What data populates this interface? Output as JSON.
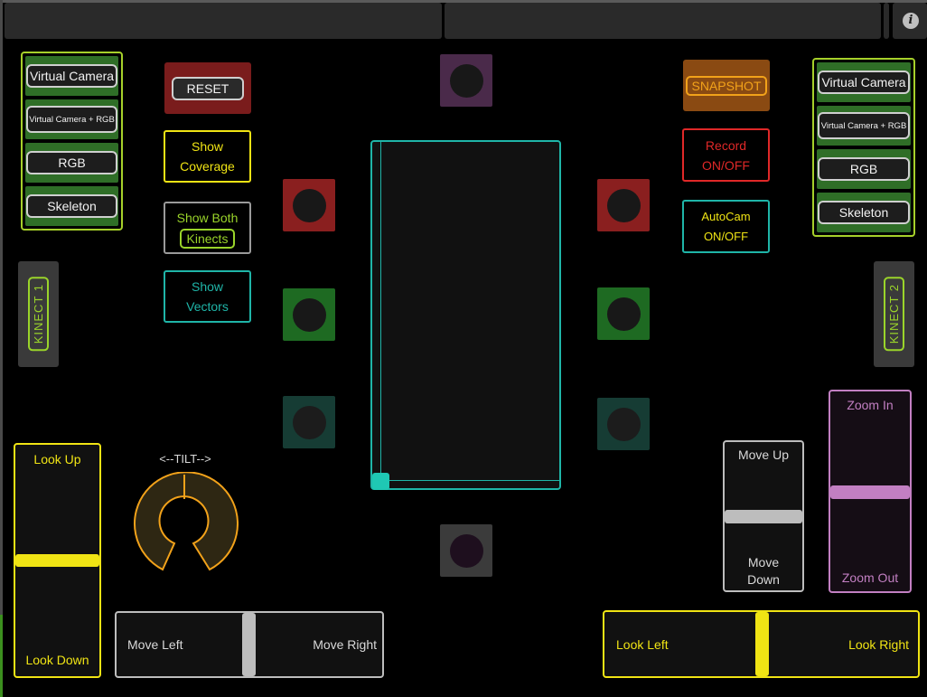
{
  "left_modes": [
    "Virtual Camera",
    "Virtual Camera + RGB",
    "RGB",
    "Skeleton"
  ],
  "right_modes": [
    "Virtual Camera",
    "Virtual Camera + RGB",
    "RGB",
    "Skeleton"
  ],
  "kinect_left": "KINECT 1",
  "kinect_right": "KINECT 2",
  "buttons": {
    "reset": "RESET",
    "show_coverage": [
      "Show",
      "Coverage"
    ],
    "show_both": [
      "Show Both",
      "Kinects"
    ],
    "show_vectors": [
      "Show",
      "Vectors"
    ],
    "snapshot": "SNAPSHOT",
    "record": [
      "Record",
      "ON/OFF"
    ],
    "autocam": [
      "AutoCam",
      "ON/OFF"
    ]
  },
  "tilt": {
    "label": "<--TILT-->"
  },
  "faders": {
    "look_vertical": {
      "top": "Look Up",
      "bottom": "Look Down",
      "value": 0.58
    },
    "move_vertical": {
      "top": "Move Up",
      "bottom": [
        "Move",
        "Down"
      ],
      "value": 0.55
    },
    "zoom": {
      "top": "Zoom In",
      "bottom": "Zoom Out",
      "value": 0.5
    },
    "move_horizontal": {
      "left": "Move Left",
      "right": "Move Right",
      "value": 0.5
    },
    "look_horizontal": {
      "left": "Look Left",
      "right": "Look Right",
      "value": 0.5
    }
  },
  "colors": {
    "lime": "#9ad42a",
    "yellow": "#f0e414",
    "teal": "#1fb5a8",
    "red": "#e02828",
    "orange": "#f2a21a",
    "purple": "#c27fc2",
    "grey": "#bdbdbd"
  },
  "icons": [
    "info-icon"
  ]
}
